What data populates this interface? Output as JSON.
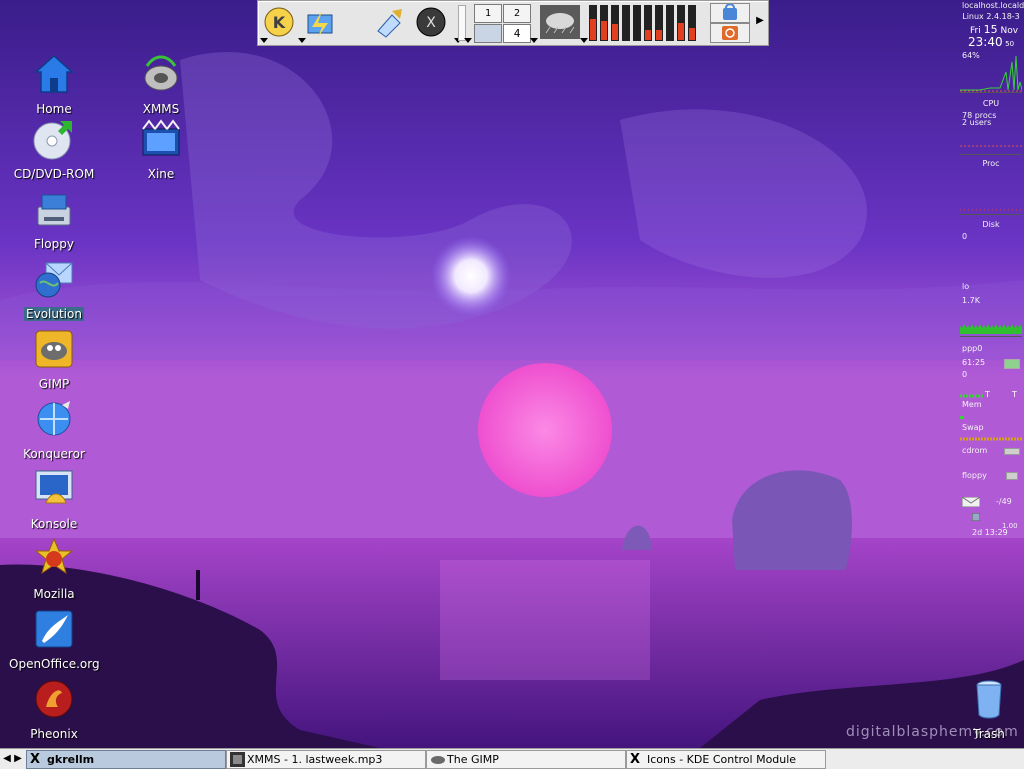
{
  "desktop": {
    "icons_left": [
      {
        "label": "Home",
        "icon": "home-icon"
      },
      {
        "label": "CD/DVD-ROM",
        "icon": "cdrom-icon"
      },
      {
        "label": "Floppy",
        "icon": "floppy-icon"
      },
      {
        "label": "Evolution",
        "icon": "evolution-icon"
      },
      {
        "label": "GIMP",
        "icon": "gimp-icon"
      },
      {
        "label": "Konqueror",
        "icon": "konqueror-icon"
      },
      {
        "label": "Konsole",
        "icon": "konsole-icon"
      },
      {
        "label": "Mozilla",
        "icon": "mozilla-icon"
      },
      {
        "label": "OpenOffice.org",
        "icon": "openoffice-icon"
      },
      {
        "label": "Pheonix",
        "icon": "pheonix-icon"
      }
    ],
    "icons_right": [
      {
        "label": "XMMS",
        "icon": "xmms-icon"
      },
      {
        "label": "Xine",
        "icon": "xine-icon"
      }
    ],
    "trash_label": "Trash",
    "watermark": "digitalblasphemy.com"
  },
  "top_panel": {
    "pager": [
      "1",
      "2",
      "",
      "4"
    ],
    "launchers": [
      "kde-menu-icon",
      "file-manager-icon",
      "kwrite-icon",
      "x-icon"
    ],
    "meters": [
      {
        "level": 0.62,
        "color": "#e0401f"
      },
      {
        "level": 0.55,
        "color": "#e0401f"
      },
      {
        "level": 0.48,
        "color": "#e0401f"
      },
      {
        "level": 0.0,
        "color": "#e0401f"
      },
      {
        "level": 0.0,
        "color": "#e0401f"
      },
      {
        "level": 0.3,
        "color": "#e0401f"
      },
      {
        "level": 0.3,
        "color": "#e0401f"
      },
      {
        "level": 0.0,
        "color": "#e0401f"
      },
      {
        "level": 0.5,
        "color": "#e0401f"
      },
      {
        "level": 0.35,
        "color": "#e0401f"
      }
    ]
  },
  "gkrellm": {
    "hostname": "localhost.locald",
    "kernel": "Linux 2.4.18-3",
    "day": "Fri",
    "date": "15",
    "month": "Nov",
    "time": "23:40",
    "seconds": "50",
    "cpu_percent": "64%",
    "cpu_label": "CPU",
    "procs": "78 procs",
    "users": "2 users",
    "proc_label": "Proc",
    "disk_label": "Disk",
    "disk_value": "0",
    "lo_label": "lo",
    "lo_value": "1.7K",
    "ppp_label": "ppp0",
    "ppp_time": "61:25",
    "ppp_value": "0",
    "mem_label": "Mem",
    "swap_label": "Swap",
    "cdrom_label": "cdrom",
    "floppy_label": "floppy",
    "mail_value": "-/49",
    "uptime_value": "2d 13:29",
    "uptime_extra": "1.00"
  },
  "taskbar": {
    "tasks": [
      {
        "label": "gkrellm",
        "icon": "x-icon",
        "active": true
      },
      {
        "label": "XMMS - 1. lastweek.mp3",
        "icon": "xmms-task-icon",
        "active": false
      },
      {
        "label": "The GIMP",
        "icon": "gimp-task-icon",
        "active": false
      },
      {
        "label": "Icons - KDE Control Module",
        "icon": "x-icon",
        "active": false
      }
    ]
  },
  "colors": {
    "sky_top": "#3a1d8a",
    "sky_mid": "#7a3fc9",
    "sun": "#ff6fd7",
    "sea": "#6a1fa8"
  }
}
